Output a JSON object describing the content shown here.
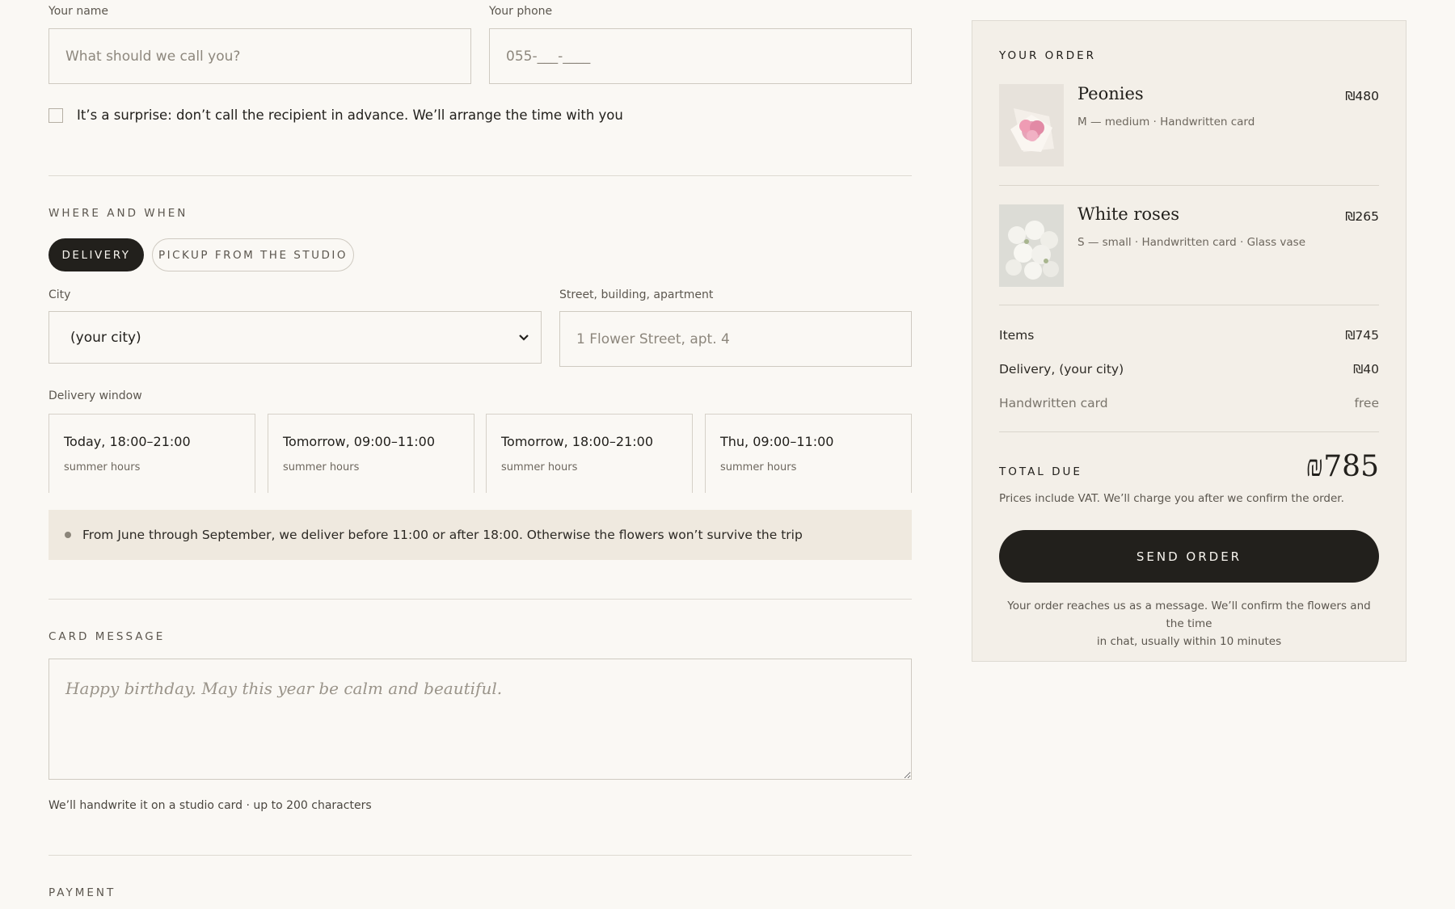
{
  "contact": {
    "name_label": "Your name",
    "name_placeholder": "What should we call you?",
    "phone_label": "Your phone",
    "phone_placeholder": "055-___-____",
    "surprise_text": "It’s a surprise: don’t call the recipient in advance. We’ll arrange the time with you"
  },
  "where_when": {
    "title": "WHERE AND WHEN",
    "tab_delivery": "DELIVERY",
    "tab_pickup": "PICKUP FROM THE STUDIO",
    "city_label": "City",
    "city_value": "(your city)",
    "street_label": "Street, building, apartment",
    "street_placeholder": "1 Flower Street, apt. 4",
    "window_label": "Delivery window",
    "slots": [
      {
        "time": "Today, 18:00–21:00",
        "note": "summer hours"
      },
      {
        "time": "Tomorrow, 09:00–11:00",
        "note": "summer hours"
      },
      {
        "time": "Tomorrow, 18:00–21:00",
        "note": "summer hours"
      },
      {
        "time": "Thu, 09:00–11:00",
        "note": "summer hours"
      }
    ],
    "notice": "From June through September, we deliver before 11:00 or after 18:00. Otherwise the flowers won’t survive the trip"
  },
  "card": {
    "title": "CARD MESSAGE",
    "placeholder": "Happy birthday. May this year be calm and beautiful.",
    "hint": "We’ll handwrite it on a studio card · up to 200 characters"
  },
  "payment": {
    "title": "PAYMENT"
  },
  "order": {
    "title": "YOUR ORDER",
    "items": [
      {
        "name": "Peonies",
        "meta": "M — medium · Handwritten card",
        "price": "₪480"
      },
      {
        "name": "White roses",
        "meta": "S — small · Handwritten card · Glass vase",
        "price": "₪265"
      }
    ],
    "items_label": "Items",
    "items_value": "₪745",
    "delivery_label": "Delivery, (your city)",
    "delivery_value": "₪40",
    "card_label": "Handwritten card",
    "card_value": "free",
    "total_label": "TOTAL DUE",
    "total_value": "₪785",
    "vat_note": "Prices include VAT. We’ll charge you after we confirm the order.",
    "send_label": "SEND ORDER",
    "footer_line1": "Your order reaches us as a message. We’ll confirm the flowers and the time",
    "footer_line2": "in chat, usually within 10 minutes"
  },
  "colors": {
    "background": "#faf8f4",
    "dark": "#22201c",
    "panel": "#f3efe8",
    "notice": "#efe9df"
  }
}
